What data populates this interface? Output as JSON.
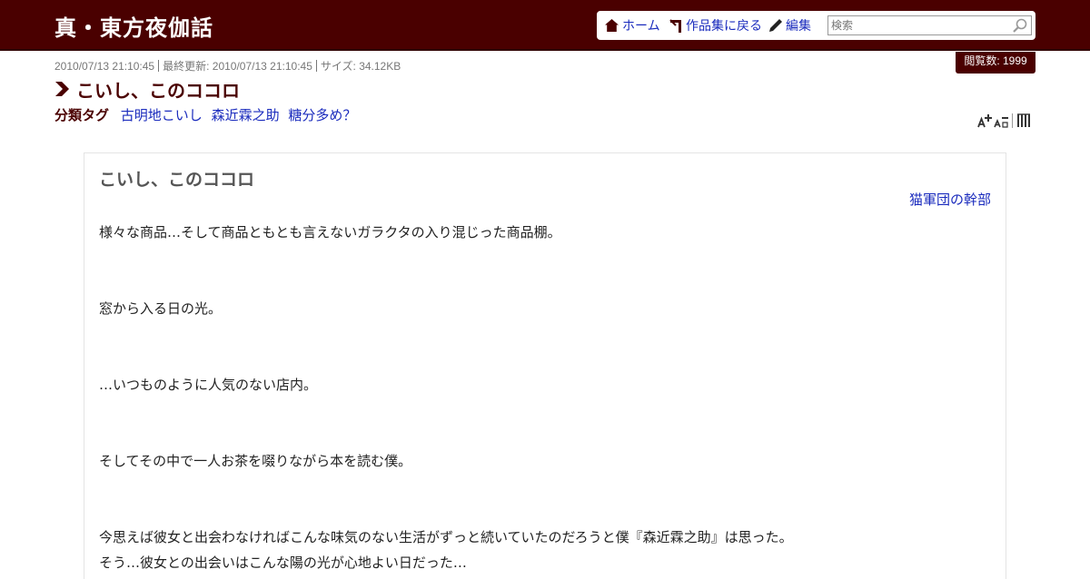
{
  "header": {
    "site_title": "真・東方夜伽話"
  },
  "nav": {
    "home": "ホーム",
    "back": "作品集に戻る",
    "edit": "編集",
    "search_placeholder": "検索"
  },
  "meta": {
    "posted": "2010/07/13 21:10:45",
    "updated": "最終更新: 2010/07/13 21:10:45",
    "size": "サイズ: 34.12KB",
    "views": "閲覧数: 1999"
  },
  "work": {
    "title": "こいし、このココロ",
    "tag_label": "分類タグ",
    "tags": [
      "古明地こいし",
      "森近霖之助",
      "糖分多め？"
    ]
  },
  "content": {
    "heading": "こいし、このココロ",
    "author": "猫軍団の幹部",
    "paragraphs": [
      "様々な商品…そして商品ともとも言えないガラクタの入り混じった商品棚。",
      "窓から入る日の光。",
      "…いつものように人気のない店内。",
      "そしてその中で一人お茶を啜りながら本を読む僕。",
      "今思えば彼女と出会わなければこんな味気のない生活がずっと続いていたのだろうと僕『森近霖之助』は思った。",
      "そう…彼女との出会いはこんな陽の光が心地よい日だった…"
    ]
  },
  "colors": {
    "header_bg": "#4a0000",
    "link": "#1a2bbd"
  }
}
